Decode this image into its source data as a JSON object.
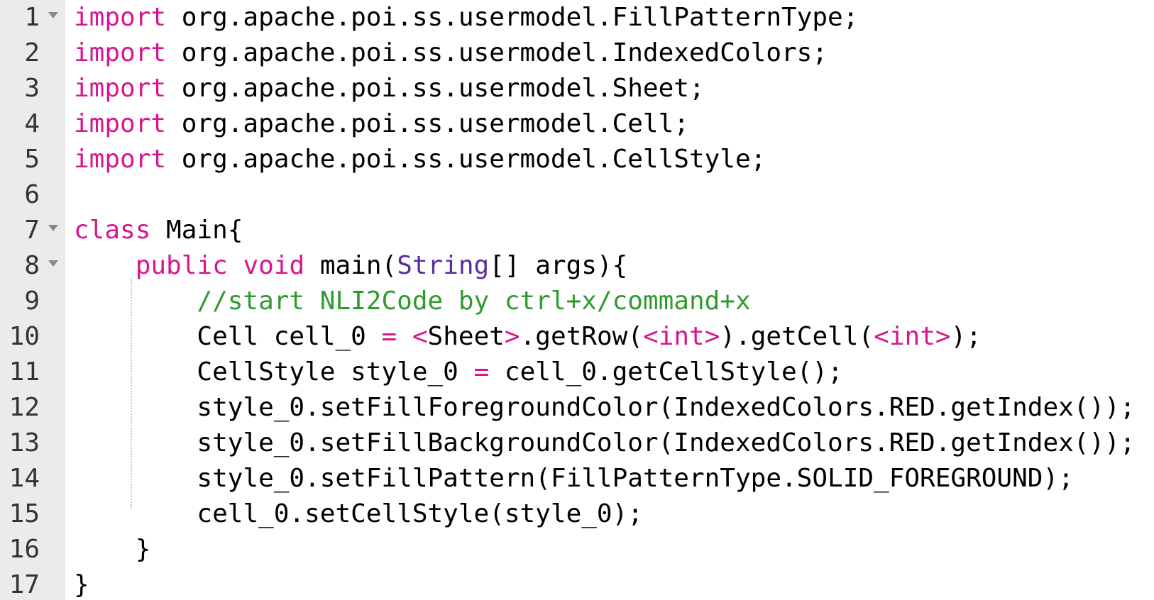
{
  "editor": {
    "lines": [
      {
        "number": "1",
        "foldable": true,
        "indent": 0,
        "tokens": [
          {
            "t": "kw",
            "v": "import"
          },
          {
            "t": "pl",
            "v": " org.apache.poi.ss.usermodel.FillPatternType;"
          }
        ]
      },
      {
        "number": "2",
        "foldable": false,
        "indent": 0,
        "tokens": [
          {
            "t": "kw",
            "v": "import"
          },
          {
            "t": "pl",
            "v": " org.apache.poi.ss.usermodel.IndexedColors;"
          }
        ]
      },
      {
        "number": "3",
        "foldable": false,
        "indent": 0,
        "tokens": [
          {
            "t": "kw",
            "v": "import"
          },
          {
            "t": "pl",
            "v": " org.apache.poi.ss.usermodel.Sheet;"
          }
        ]
      },
      {
        "number": "4",
        "foldable": false,
        "indent": 0,
        "tokens": [
          {
            "t": "kw",
            "v": "import"
          },
          {
            "t": "pl",
            "v": " org.apache.poi.ss.usermodel.Cell;"
          }
        ]
      },
      {
        "number": "5",
        "foldable": false,
        "indent": 0,
        "tokens": [
          {
            "t": "kw",
            "v": "import"
          },
          {
            "t": "pl",
            "v": " org.apache.poi.ss.usermodel.CellStyle;"
          }
        ]
      },
      {
        "number": "6",
        "foldable": false,
        "indent": 0,
        "tokens": []
      },
      {
        "number": "7",
        "foldable": true,
        "indent": 0,
        "tokens": [
          {
            "t": "kw",
            "v": "class"
          },
          {
            "t": "pl",
            "v": " Main{"
          }
        ]
      },
      {
        "number": "8",
        "foldable": true,
        "indent": 1,
        "tokens": [
          {
            "t": "kw",
            "v": "public"
          },
          {
            "t": "pl",
            "v": " "
          },
          {
            "t": "kw",
            "v": "void"
          },
          {
            "t": "pl",
            "v": " main("
          },
          {
            "t": "type",
            "v": "String"
          },
          {
            "t": "pl",
            "v": "[] args){"
          }
        ]
      },
      {
        "number": "9",
        "foldable": false,
        "indent": 2,
        "tokens": [
          {
            "t": "cm",
            "v": "//start NLI2Code by ctrl+x/command+x"
          }
        ]
      },
      {
        "number": "10",
        "foldable": false,
        "indent": 2,
        "tokens": [
          {
            "t": "pl",
            "v": "Cell cell_0 "
          },
          {
            "t": "op",
            "v": "="
          },
          {
            "t": "pl",
            "v": " "
          },
          {
            "t": "op",
            "v": "<"
          },
          {
            "t": "pl",
            "v": "Sheet"
          },
          {
            "t": "op",
            "v": ">"
          },
          {
            "t": "pl",
            "v": ".getRow("
          },
          {
            "t": "op",
            "v": "<"
          },
          {
            "t": "kw",
            "v": "int"
          },
          {
            "t": "op",
            "v": ">"
          },
          {
            "t": "pl",
            "v": ").getCell("
          },
          {
            "t": "op",
            "v": "<"
          },
          {
            "t": "kw",
            "v": "int"
          },
          {
            "t": "op",
            "v": ">"
          },
          {
            "t": "pl",
            "v": ");"
          }
        ]
      },
      {
        "number": "11",
        "foldable": false,
        "indent": 2,
        "tokens": [
          {
            "t": "pl",
            "v": "CellStyle style_0 "
          },
          {
            "t": "op",
            "v": "="
          },
          {
            "t": "pl",
            "v": " cell_0.getCellStyle();"
          }
        ]
      },
      {
        "number": "12",
        "foldable": false,
        "indent": 2,
        "tokens": [
          {
            "t": "pl",
            "v": "style_0.setFillForegroundColor(IndexedColors.RED.getIndex());"
          }
        ]
      },
      {
        "number": "13",
        "foldable": false,
        "indent": 2,
        "tokens": [
          {
            "t": "pl",
            "v": "style_0.setFillBackgroundColor(IndexedColors.RED.getIndex());"
          }
        ]
      },
      {
        "number": "14",
        "foldable": false,
        "indent": 2,
        "tokens": [
          {
            "t": "pl",
            "v": "style_0.setFillPattern(FillPatternType.SOLID_FOREGROUND);"
          }
        ]
      },
      {
        "number": "15",
        "foldable": false,
        "indent": 2,
        "tokens": [
          {
            "t": "pl",
            "v": "cell_0.setCellStyle(style_0);"
          }
        ]
      },
      {
        "number": "16",
        "foldable": false,
        "indent": 1,
        "tokens": [
          {
            "t": "pl",
            "v": "}"
          }
        ]
      },
      {
        "number": "17",
        "foldable": false,
        "indent": 0,
        "tokens": [
          {
            "t": "pl",
            "v": "}"
          }
        ]
      }
    ]
  },
  "colors": {
    "keyword": "#d8158f",
    "type": "#5b2c9e",
    "comment": "#2e9b2e",
    "gutter_background": "#ebebeb",
    "text": "#000000"
  },
  "icons": {
    "fold": "fold-arrow-icon"
  }
}
